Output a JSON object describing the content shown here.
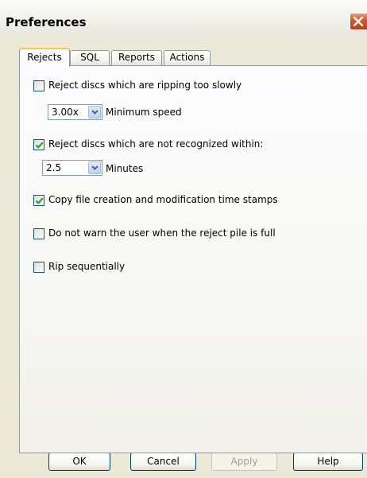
{
  "window": {
    "title": "Preferences"
  },
  "tabs": [
    {
      "label": "Rejects",
      "active": true
    },
    {
      "label": "SQL",
      "active": false
    },
    {
      "label": "Reports",
      "active": false
    },
    {
      "label": "Actions",
      "active": false
    }
  ],
  "rejects": {
    "slow_ripping": {
      "label": "Reject discs which are ripping too slowly",
      "checked": false
    },
    "min_speed": {
      "value": "3.00x",
      "caption": "Minimum speed"
    },
    "not_recognized": {
      "label": "Reject discs which are not recognized within:",
      "checked": true
    },
    "minutes": {
      "value": "2.5",
      "caption": "Minutes"
    },
    "copy_timestamps": {
      "label": "Copy file creation and modification time stamps",
      "checked": true
    },
    "no_warn_full": {
      "label": "Do not warn the user when the reject pile is full",
      "checked": false
    },
    "rip_sequentially": {
      "label": "Rip sequentially",
      "checked": false
    }
  },
  "buttons": {
    "ok": "OK",
    "cancel": "Cancel",
    "apply": "Apply",
    "help": "Help"
  },
  "colors": {
    "check": "#21a121",
    "tab_highlight": "#ffc83c",
    "close": "#d6552f"
  }
}
